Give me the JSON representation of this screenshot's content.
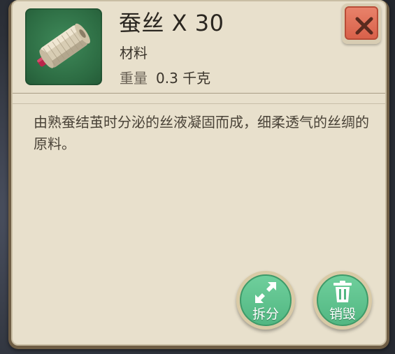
{
  "item": {
    "name": "蚕丝 X 30",
    "type": "材料",
    "weight_label": "重量",
    "weight_value": "0.3 千克",
    "icon": "silk-spool-icon",
    "description": "由熟蚕结茧时分泌的丝液凝固而成，细柔透气的丝绸的原料。"
  },
  "buttons": {
    "close_icon": "close-icon",
    "split_label": "拆分",
    "split_icon": "expand-arrows-icon",
    "destroy_label": "销毁",
    "destroy_icon": "trash-icon"
  },
  "colors": {
    "panel_bg": "#e8e0cc",
    "close_red": "#d9614a",
    "action_green": "#52b782",
    "icon_bg_green": "#2c6b42"
  }
}
